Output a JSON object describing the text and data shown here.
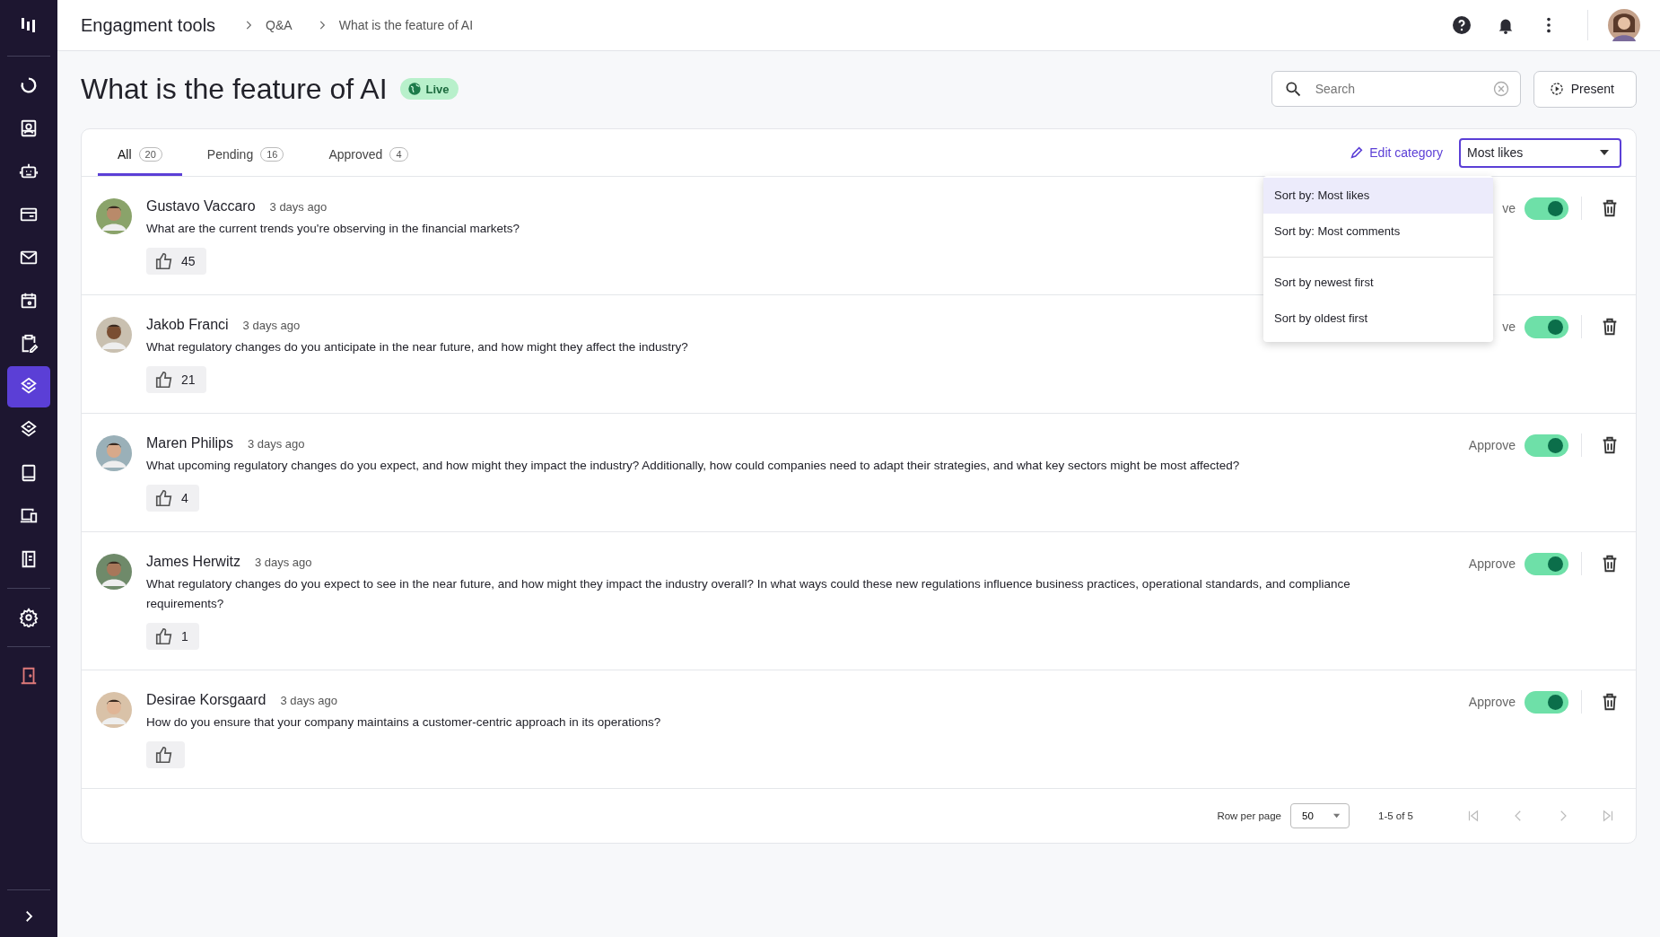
{
  "sidebar": {
    "items": [
      {
        "kind": "progress",
        "selected": false
      },
      {
        "kind": "contact",
        "selected": false
      },
      {
        "kind": "robot",
        "selected": false
      },
      {
        "kind": "card",
        "selected": false
      },
      {
        "kind": "mail",
        "selected": false
      },
      {
        "kind": "calendar",
        "selected": false
      },
      {
        "kind": "clipboard",
        "selected": false
      },
      {
        "kind": "layers",
        "selected": true
      },
      {
        "kind": "layers",
        "selected": false
      },
      {
        "kind": "tablet",
        "selected": false
      },
      {
        "kind": "devices",
        "selected": false
      },
      {
        "kind": "document",
        "selected": false
      }
    ],
    "footer_items": [
      {
        "kind": "settings"
      },
      {
        "kind": "door"
      }
    ]
  },
  "breadcrumb": [
    "Engagment tools",
    "Q&A",
    "What is the feature of AI"
  ],
  "page": {
    "title": "What is the feature of AI",
    "status": "Live"
  },
  "search": {
    "placeholder": "Search"
  },
  "present_button": "Present",
  "tabs": [
    {
      "label": "All",
      "count": "20",
      "selected": true
    },
    {
      "label": "Pending",
      "count": "16",
      "selected": false
    },
    {
      "label": "Approved",
      "count": "4",
      "selected": false
    }
  ],
  "edit_category": "Edit category",
  "sort_select": {
    "value": "Most likes",
    "expanded": true,
    "options": [
      {
        "label": "Sort by: Most likes",
        "selected": true
      },
      {
        "label": "Sort by: Most comments",
        "selected": false
      },
      {
        "label": "Sort by newest first",
        "selected": false,
        "group_start": true
      },
      {
        "label": "Sort by oldest first",
        "selected": false
      }
    ]
  },
  "questions": [
    {
      "name": "Gustavo Vaccaro",
      "time": "3 days ago",
      "text": "What are the current trends you're observing in the financial markets?",
      "likes": "45",
      "approve_label": "ve",
      "approved": true
    },
    {
      "name": "Jakob Franci",
      "time": "3 days ago",
      "text": "What regulatory changes do you anticipate in the near future, and how might they affect the industry?",
      "likes": "21",
      "approve_label": "ve",
      "approved": true
    },
    {
      "name": "Maren Philips",
      "time": "3 days ago",
      "text": "What upcoming regulatory changes do you expect, and how might they impact the industry? Additionally, how could companies need to adapt their strategies, and what key sectors might be most affected?",
      "likes": "4",
      "approve_label": "Approve",
      "approved": true
    },
    {
      "name": "James Herwitz",
      "time": "3 days ago",
      "text": "What regulatory changes do you expect to see in the near future, and how might they impact the industry overall? In what ways could these new regulations influence business practices, operational standards, and compliance requirements?",
      "likes": "1",
      "approve_label": "Approve",
      "approved": true
    },
    {
      "name": "Desirae Korsgaard",
      "time": "3 days ago",
      "text": "How do you ensure that your company maintains a customer-centric approach in its operations?",
      "approve_label": "Approve",
      "approved": true
    }
  ],
  "pagination": {
    "label": "Row per page",
    "per_page": "50",
    "range": "1-5 of 5"
  }
}
